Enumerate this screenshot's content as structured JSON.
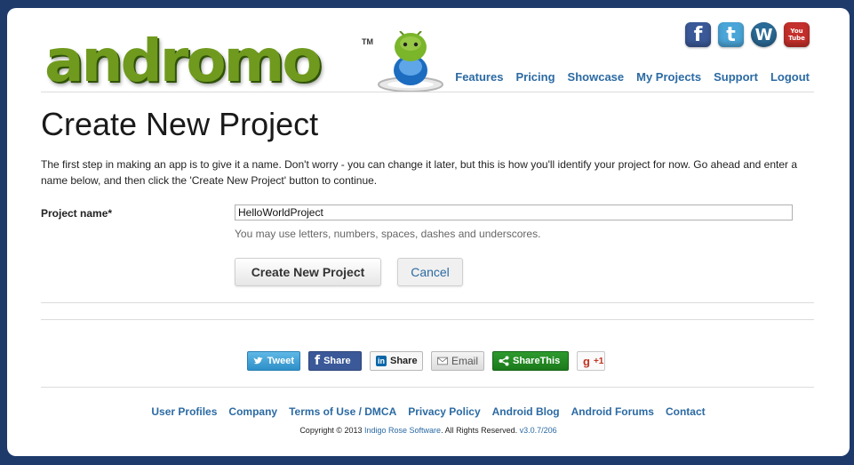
{
  "header": {
    "logo_text": "andromo",
    "logo_tm": "TM",
    "social": [
      {
        "icon": "facebook-icon",
        "glyph": "f"
      },
      {
        "icon": "twitter-icon",
        "glyph": "t"
      },
      {
        "icon": "wordpress-icon",
        "glyph": "W"
      },
      {
        "icon": "youtube-icon",
        "glyph": "You Tube"
      }
    ],
    "nav": [
      "Features",
      "Pricing",
      "Showcase",
      "My Projects",
      "Support",
      "Logout"
    ]
  },
  "main": {
    "title": "Create New Project",
    "intro": "The first step in making an app is to give it a name. Don't worry - you can change it later, but this is how you'll identify your project for now. Go ahead and enter a name below, and then click the 'Create New Project' button to continue.",
    "field_label": "Project name*",
    "field_value": "HelloWorldProject",
    "field_help": "You may use letters, numbers, spaces, dashes and underscores.",
    "create_label": "Create New Project",
    "cancel_label": "Cancel"
  },
  "share": {
    "tweet": "Tweet",
    "facebook": "Share",
    "linkedin": "Share",
    "linkedin_badge": "in",
    "email": "Email",
    "sharethis": "ShareThis",
    "gplus": "+1",
    "gplus_badge": "g"
  },
  "footer": {
    "links": [
      "User Profiles",
      "Company",
      "Terms of Use / DMCA",
      "Privacy Policy",
      "Android Blog",
      "Android Forums",
      "Contact"
    ],
    "copyright_prefix": "Copyright © 2013",
    "company": "Indigo Rose Software",
    "rights": ". All Rights Reserved.",
    "version": "v3.0.7/206"
  },
  "colors": {
    "background": "#1d3a6b",
    "link": "#2b6aa3",
    "logo_green": "#6f9a1e"
  }
}
